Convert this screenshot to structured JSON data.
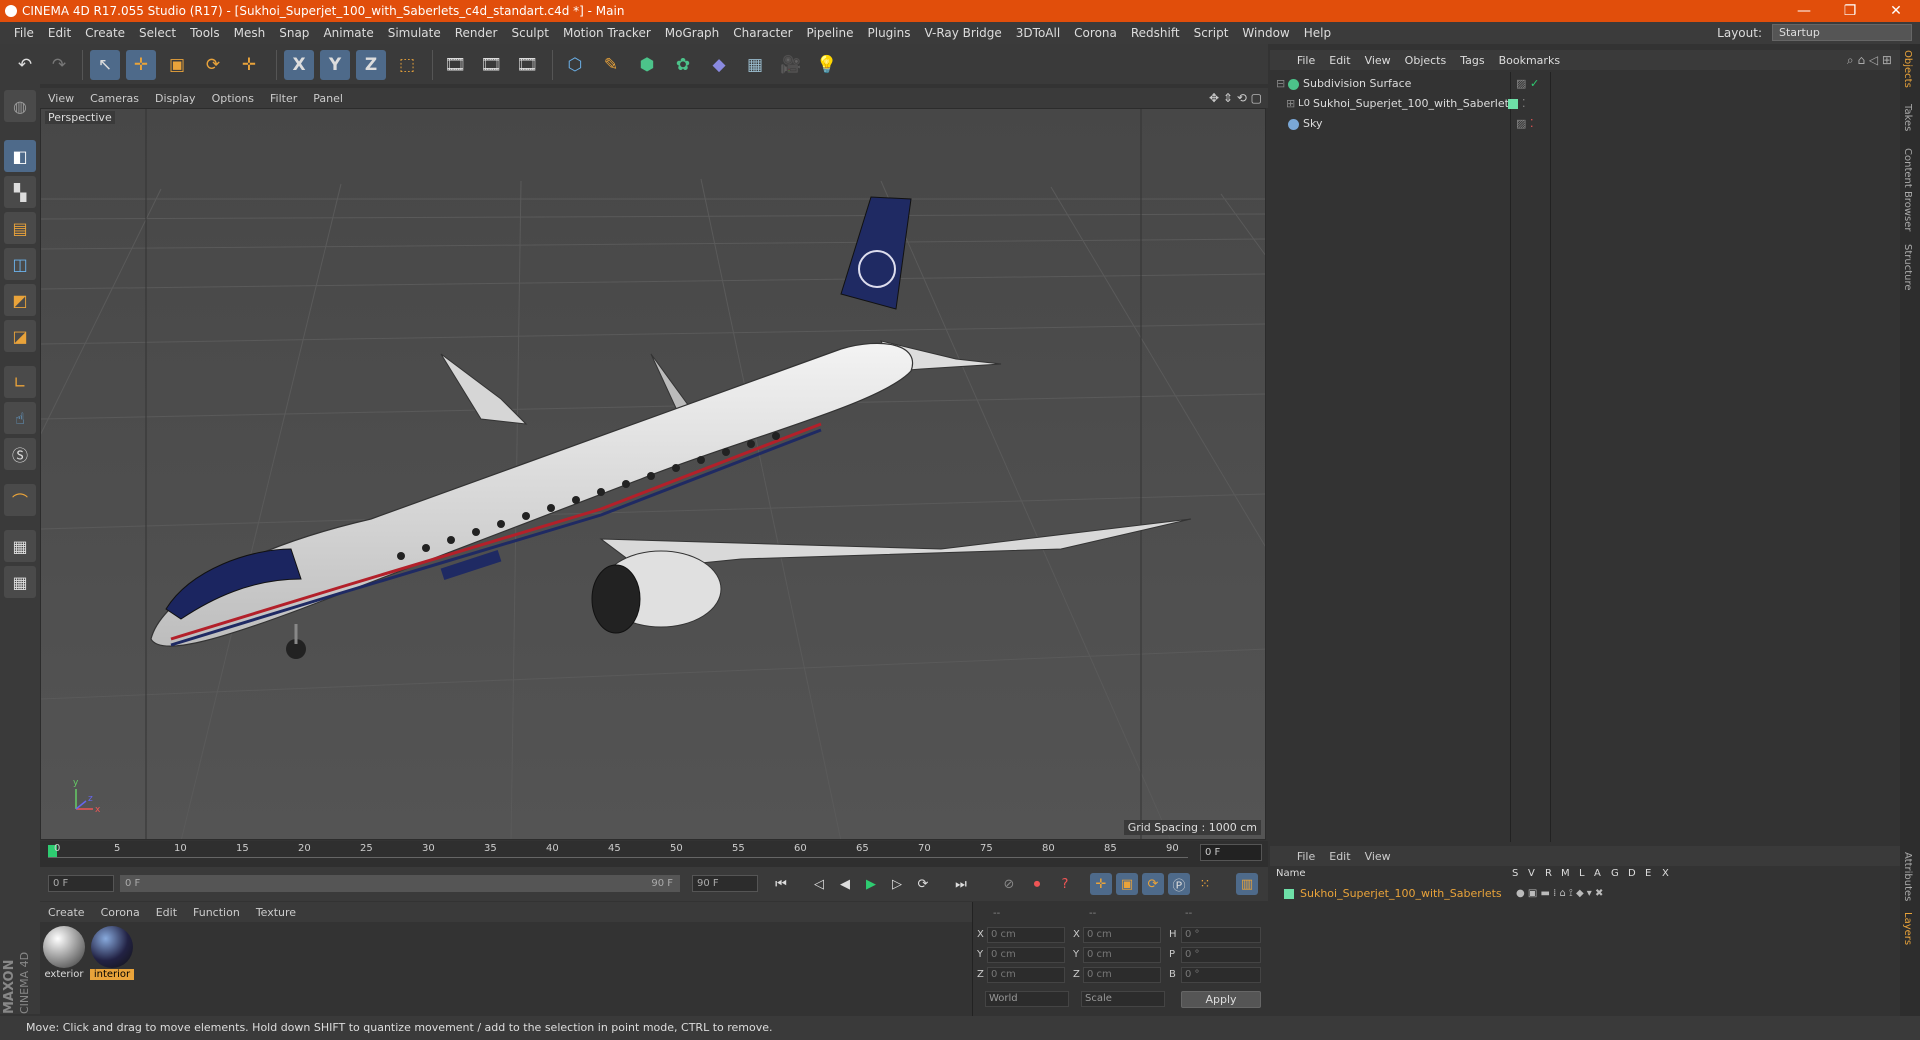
{
  "window": {
    "title": "CINEMA 4D R17.055 Studio (R17) - [Sukhoi_Superjet_100_with_Saberlets_c4d_standart.c4d *] - Main",
    "minimize": "—",
    "restore": "❐",
    "close": "✕"
  },
  "menubar": [
    "File",
    "Edit",
    "Create",
    "Select",
    "Tools",
    "Mesh",
    "Snap",
    "Animate",
    "Simulate",
    "Render",
    "Sculpt",
    "Motion Tracker",
    "MoGraph",
    "Character",
    "Pipeline",
    "Plugins",
    "V-Ray Bridge",
    "3DToAll",
    "Corona",
    "Redshift",
    "Script",
    "Window",
    "Help"
  ],
  "layout": {
    "label": "Layout:",
    "value": "Startup"
  },
  "toolbar": {
    "undo": "↶",
    "redo": "↷",
    "select": "↖",
    "move": "✛",
    "scale": "▣",
    "rotate": "⟳",
    "move2": "✛",
    "x": "X",
    "y": "Y",
    "z": "Z",
    "coord": "⬚",
    "render1": "🎞",
    "render2": "🎞",
    "render3": "🎞",
    "cube": "⬡",
    "pen": "✎",
    "subdiv": "⬢",
    "array": "✿",
    "deform": "◆",
    "floor": "▦",
    "camera": "🎥",
    "light": "💡"
  },
  "viewport": {
    "menu": [
      "View",
      "Cameras",
      "Display",
      "Options",
      "Filter",
      "Panel"
    ],
    "label": "Perspective",
    "grid_spacing": "Grid Spacing : 1000 cm",
    "axes": {
      "x": "x",
      "y": "y",
      "z": "z"
    }
  },
  "timeline": {
    "ticks": [
      "0",
      "5",
      "10",
      "15",
      "20",
      "25",
      "30",
      "35",
      "40",
      "45",
      "50",
      "55",
      "60",
      "65",
      "70",
      "75",
      "80",
      "85",
      "90"
    ],
    "current_frame": "0 F"
  },
  "playbar": {
    "start": "0 F",
    "range_start": "0 F",
    "range_end": "90 F",
    "end": "90 F"
  },
  "materials": {
    "menu": [
      "Create",
      "Corona",
      "Edit",
      "Function",
      "Texture"
    ],
    "items": [
      {
        "name": "exterior"
      },
      {
        "name": "interior"
      }
    ]
  },
  "coords": {
    "header": [
      "--",
      "--",
      "--"
    ],
    "rows": [
      {
        "a": "X",
        "av": "0 cm",
        "b": "X",
        "bv": "0 cm",
        "c": "H",
        "cv": "0 °"
      },
      {
        "a": "Y",
        "av": "0 cm",
        "b": "Y",
        "bv": "0 cm",
        "c": "P",
        "cv": "0 °"
      },
      {
        "a": "Z",
        "av": "0 cm",
        "b": "Z",
        "bv": "0 cm",
        "c": "B",
        "cv": "0 °"
      }
    ],
    "world": "World",
    "scale": "Scale",
    "apply": "Apply"
  },
  "objects": {
    "menu": [
      "File",
      "Edit",
      "View",
      "Objects",
      "Tags",
      "Bookmarks"
    ],
    "rows": [
      {
        "name": "Subdivision Surface",
        "color": "#4cc38a"
      },
      {
        "name": "Sukhoi_Superjet_100_with_Saberlets",
        "color": "#9aa"
      },
      {
        "name": "Sky",
        "color": "#7aa7d6"
      }
    ]
  },
  "layers": {
    "menu": [
      "File",
      "Edit",
      "View"
    ],
    "columns": [
      "Name",
      "S",
      "V",
      "R",
      "M",
      "L",
      "A",
      "G",
      "D",
      "E",
      "X"
    ],
    "rows": [
      {
        "name": "Sukhoi_Superjet_100_with_Saberlets"
      }
    ]
  },
  "rightstrip": [
    "Objects",
    "Takes",
    "Content Browser",
    "Structure"
  ],
  "rightstrip_bottom": [
    "Attributes",
    "Layers"
  ],
  "brand": {
    "maxon": "MAXON",
    "c4d": "CINEMA 4D"
  },
  "status": "Move: Click and drag to move elements. Hold down SHIFT to quantize movement / add to the selection in point mode, CTRL to remove."
}
